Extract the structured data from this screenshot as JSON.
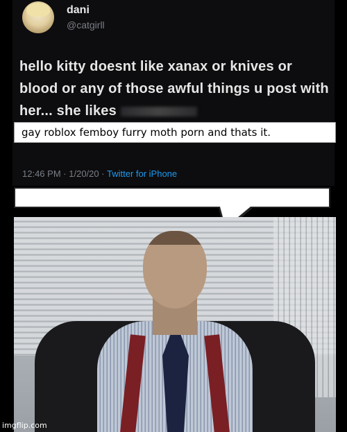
{
  "tweet": {
    "display_name": "dani",
    "handle": "@catgirll",
    "text": "hello kitty doesnt like xanax or knives or blood or any of those awful things u post with her... she likes",
    "overlay_text": "gay roblox femboy furry moth porn and thats it.",
    "time": "12:46 PM",
    "date": "1/20/20",
    "client": "Twitter for iPhone"
  },
  "watermark": "imgflip.com"
}
